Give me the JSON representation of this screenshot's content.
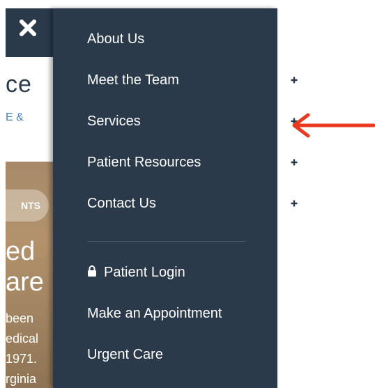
{
  "background": {
    "heading_fragment": "ce",
    "link_fragment": "E &",
    "badge_fragment": "NTS",
    "hero_title_lines": [
      "ed",
      "are"
    ],
    "hero_text_lines": [
      "been",
      "edical",
      "1971.",
      "rginia"
    ]
  },
  "close": {
    "icon": "close-icon"
  },
  "menu": {
    "items": [
      {
        "label": "About Us",
        "expandable": false
      },
      {
        "label": "Meet the Team",
        "expandable": true
      },
      {
        "label": "Services",
        "expandable": true
      },
      {
        "label": "Patient Resources",
        "expandable": true
      },
      {
        "label": "Contact Us",
        "expandable": true
      }
    ],
    "secondary": [
      {
        "label": "Patient Login",
        "icon": "lock-icon"
      },
      {
        "label": "Make an Appointment"
      },
      {
        "label": "Urgent Care"
      }
    ]
  },
  "colors": {
    "menu_bg": "#2b3a4b",
    "arrow": "#e8381e"
  }
}
